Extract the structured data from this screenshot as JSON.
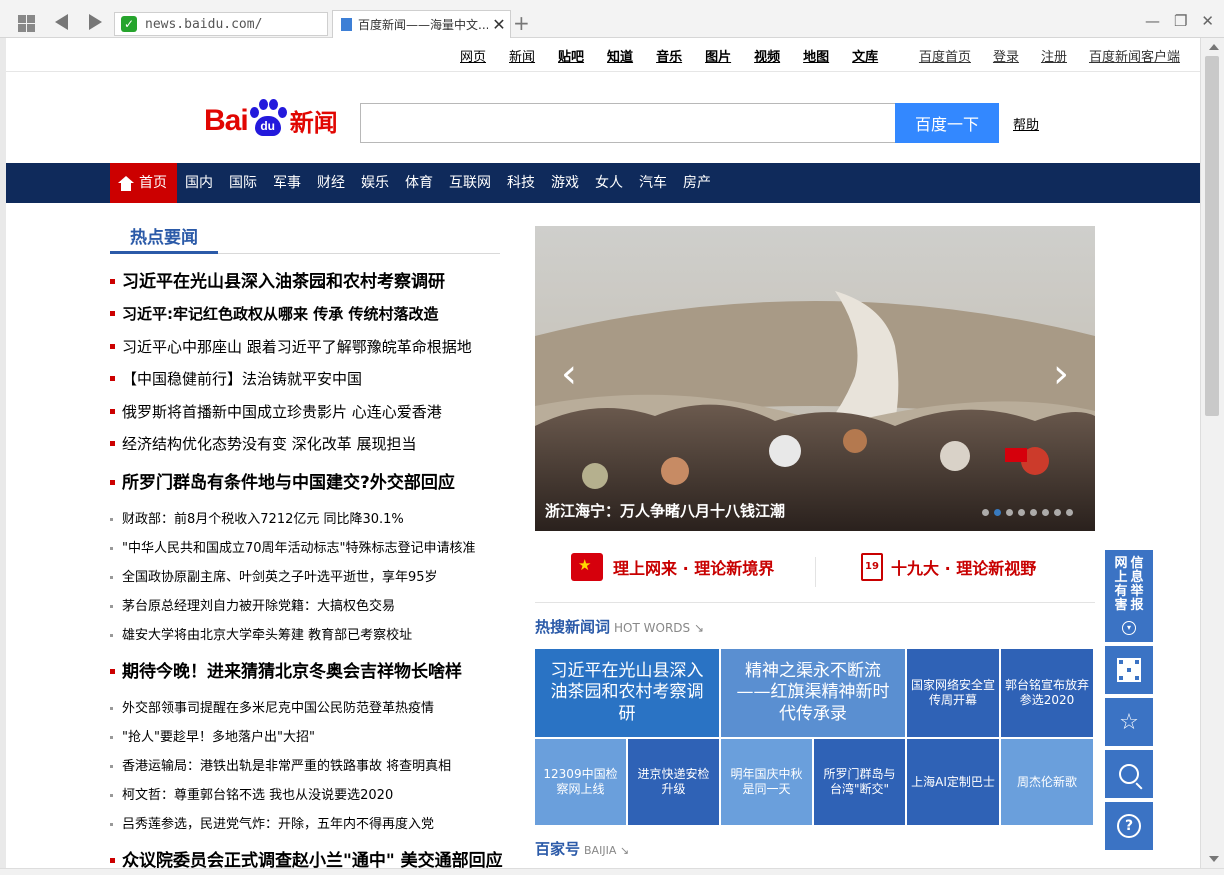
{
  "browser": {
    "url": "news.baidu.com/",
    "tab_title": "百度新闻——海量中文...",
    "close": "✕",
    "new_tab": "+",
    "window_min": "—",
    "window_max": "❐",
    "window_close": "✕"
  },
  "toplinks": [
    "网页",
    "新闻",
    "贴吧",
    "知道",
    "音乐",
    "图片",
    "视频",
    "地图",
    "文库"
  ],
  "rightlinks": [
    "百度首页",
    "登录",
    "注册",
    "百度新闻客户端"
  ],
  "logo": {
    "bai": "Bai",
    "du": "du",
    "xinwen": "新闻"
  },
  "search": {
    "button": "百度一下",
    "help": "帮助",
    "value": ""
  },
  "channel": [
    "首页",
    "国内",
    "国际",
    "军事",
    "财经",
    "娱乐",
    "体育",
    "互联网",
    "科技",
    "游戏",
    "女人",
    "汽车",
    "房产"
  ],
  "hot": {
    "title": "热点要闻",
    "items": [
      {
        "text": "习近平在光山县深入油茶园和农村考察调研",
        "style": "big"
      },
      {
        "text": "习近平:牢记红色政权从哪来 传承 传统村落改造",
        "style": "mid-b"
      },
      {
        "text": "习近平心中那座山 跟着习近平了解鄂豫皖革命根据地",
        "style": "mid"
      },
      {
        "text": "【中国稳健前行】法治铸就平安中国",
        "style": "mid"
      },
      {
        "text": "俄罗斯将首播新中国成立珍贵影片 心连心爱香港",
        "style": "mid"
      },
      {
        "text": "经济结构优化态势没有变 深化改革 展现担当",
        "style": "mid"
      },
      {
        "text": "所罗门群岛有条件地与中国建交?外交部回应",
        "style": "big"
      },
      {
        "text": "财政部：前8月个税收入7212亿元 同比降30.1%",
        "style": "small"
      },
      {
        "text": "\"中华人民共和国成立70周年活动标志\"特殊标志登记申请核准",
        "style": "small"
      },
      {
        "text": "全国政协原副主席、叶剑英之子叶选平逝世，享年95岁",
        "style": "small"
      },
      {
        "text": "茅台原总经理刘自力被开除党籍：大搞权色交易",
        "style": "small"
      },
      {
        "text": "雄安大学将由北京大学牵头筹建 教育部已考察校址",
        "style": "small"
      },
      {
        "text": "期待今晚！进来猜猜北京冬奥会吉祥物长啥样",
        "style": "big"
      },
      {
        "text": "外交部领事司提醒在多米尼克中国公民防范登革热疫情",
        "style": "small"
      },
      {
        "text": "\"抢人\"要趁早！多地落户出\"大招\"",
        "style": "small"
      },
      {
        "text": "香港运输局：港铁出轨是非常严重的铁路事故 将查明真相",
        "style": "small"
      },
      {
        "text": "柯文哲：尊重郭台铭不选 我也从没说要选2020",
        "style": "small"
      },
      {
        "text": "吕秀莲参选，民进党气炸：开除，五年内不得再度入党",
        "style": "small"
      },
      {
        "text": "众议院委员会正式调查赵小兰\"通中\" 美交通部回应",
        "style": "big"
      }
    ]
  },
  "slide": {
    "caption": "浙江海宁：万人争睹八月十八钱江潮",
    "prev": "‹",
    "next": "›",
    "dots": 8,
    "active_dot": 1
  },
  "banners": {
    "left": "理上网来 · 理论新境界",
    "right": "十九大 · 理论新视野",
    "cal": "19"
  },
  "hotwords": {
    "title": "热搜新闻词",
    "subtitle": "HOT WORDS ↘",
    "cells": [
      "习近平在光山县深入油茶园和农村考察调研",
      "精神之渠永不断流——红旗渠精神新时代传承录",
      "国家网络安全宣传周开幕",
      "郭台铭宣布放弃参选2020",
      "12309中国检察网上线",
      "进京快递安检升级",
      "明年国庆中秋是同一天",
      "所罗门群岛与台湾\"断交\"",
      "上海AI定制巴士",
      "周杰伦新歌"
    ]
  },
  "baijia": {
    "title": "百家号",
    "subtitle": "BAIJIA ↘"
  },
  "sidebar": {
    "report_col1": [
      "网",
      "上",
      "有",
      "害"
    ],
    "report_col2": [
      "信",
      "息",
      "举",
      "报"
    ],
    "star": "☆",
    "question": "?",
    "arrow": "▾"
  }
}
